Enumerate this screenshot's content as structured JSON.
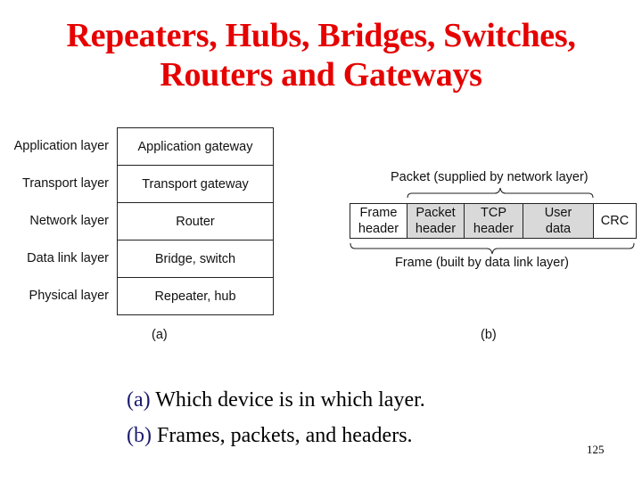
{
  "slide": {
    "title_lines": [
      "Repeaters, Hubs, Bridges, Switches,",
      "Routers and Gateways"
    ],
    "title_color": "#e60000",
    "page_number": "125"
  },
  "figure_a": {
    "label": "(a)",
    "rows": [
      {
        "layer": "Application layer",
        "device": "Application gateway"
      },
      {
        "layer": "Transport layer",
        "device": "Transport gateway"
      },
      {
        "layer": "Network layer",
        "device": "Router"
      },
      {
        "layer": "Data link layer",
        "device": "Bridge, switch"
      },
      {
        "layer": "Physical layer",
        "device": "Repeater, hub"
      }
    ]
  },
  "figure_b": {
    "label": "(b)",
    "packet_brace_label": "Packet (supplied by network layer)",
    "frame_brace_label": "Frame (built by data link layer)",
    "fields": [
      {
        "line1": "Frame",
        "line2": "header",
        "shaded": false
      },
      {
        "line1": "Packet",
        "line2": "header",
        "shaded": true
      },
      {
        "line1": "TCP",
        "line2": "header",
        "shaded": true
      },
      {
        "line1": "User",
        "line2": "data",
        "shaded": true
      },
      {
        "line1": "CRC",
        "line2": "",
        "shaded": false
      }
    ],
    "shade_color": "#d9d9d9"
  },
  "captions": [
    {
      "prefix": "(a)",
      "text": " Which device is in which layer."
    },
    {
      "prefix": "(b)",
      "text": " Frames, packets, and headers."
    }
  ]
}
